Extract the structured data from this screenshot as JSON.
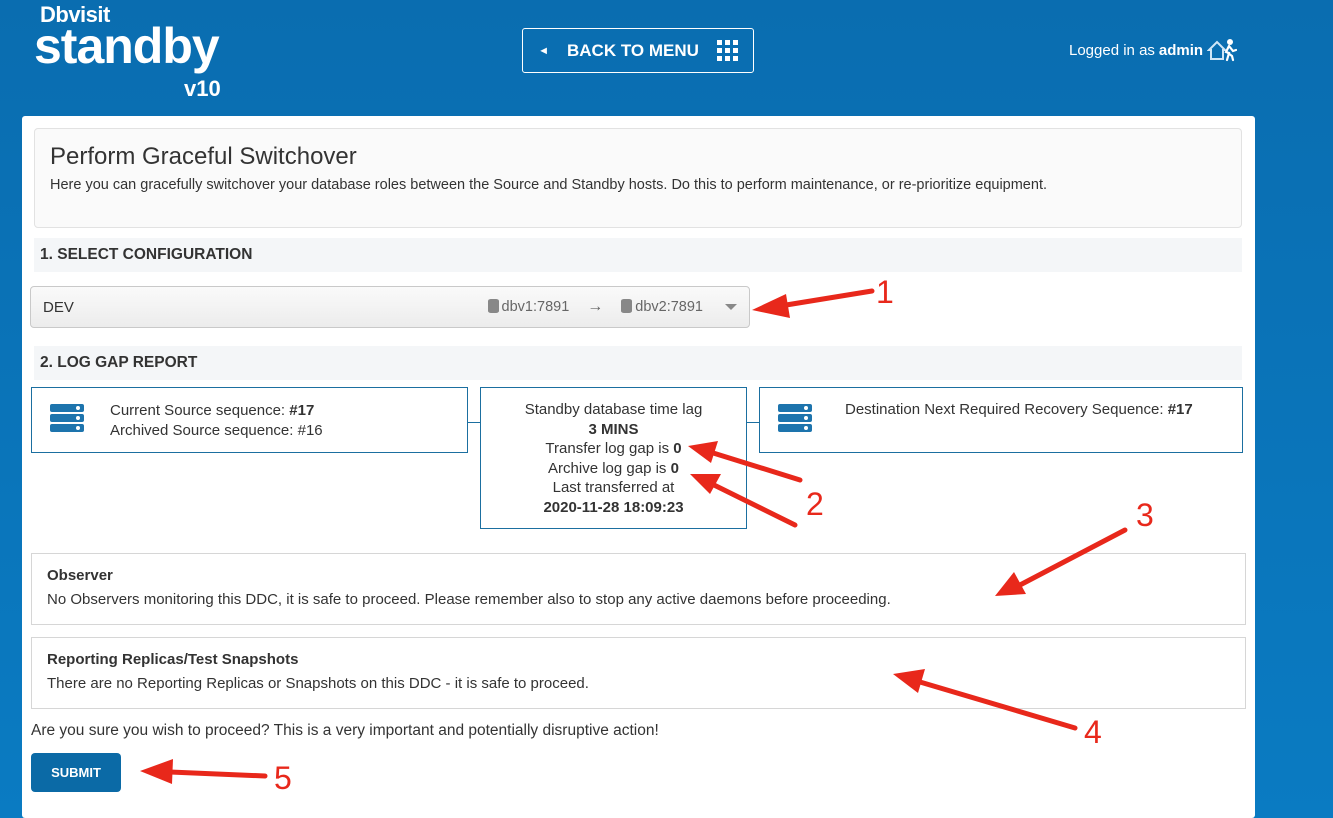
{
  "brand": {
    "small": "Dbvisit",
    "big": "standby",
    "version": "v10"
  },
  "header": {
    "back_label": "BACK TO MENU",
    "logged_prefix": "Logged in as",
    "user": "admin"
  },
  "intro": {
    "title": "Perform Graceful Switchover",
    "description": "Here you can gracefully switchover your database roles between the Source and Standby hosts. Do this to perform maintenance, or re-prioritize equipment."
  },
  "section1": {
    "title": "1. SELECT CONFIGURATION"
  },
  "config": {
    "name": "DEV",
    "source_host": "dbv1:7891",
    "target_host": "dbv2:7891"
  },
  "section2": {
    "title": "2. LOG GAP REPORT"
  },
  "log_gap": {
    "current_source_label": "Current Source sequence: ",
    "current_source_value": "#17",
    "archived_source": "Archived Source sequence: #16",
    "time_lag_label": "Standby database time lag",
    "time_lag_value": "3 MINS",
    "transfer_gap_label": "Transfer log gap is ",
    "transfer_gap_value": "0",
    "archive_gap_label": "Archive log gap is ",
    "archive_gap_value": "0",
    "last_transferred_label": "Last transferred at",
    "last_transferred_value": "2020-11-28 18:09:23",
    "dest_label": "Destination Next Required Recovery Sequence: ",
    "dest_value": "#17"
  },
  "observer": {
    "title": "Observer",
    "text": "No Observers monitoring this DDC, it is safe to proceed. Please remember also to stop any active daemons before proceeding."
  },
  "replicas": {
    "title": "Reporting Replicas/Test Snapshots",
    "text": "There are no Reporting Replicas or Snapshots on this DDC - it is safe to proceed."
  },
  "confirm_text": "Are you sure you wish to proceed? This is a very important and potentially disruptive action!",
  "submit_label": "SUBMIT",
  "annotations": {
    "n1": "1",
    "n2": "2",
    "n3": "3",
    "n4": "4",
    "n5": "5",
    "arrow_color": "#e8281b"
  }
}
